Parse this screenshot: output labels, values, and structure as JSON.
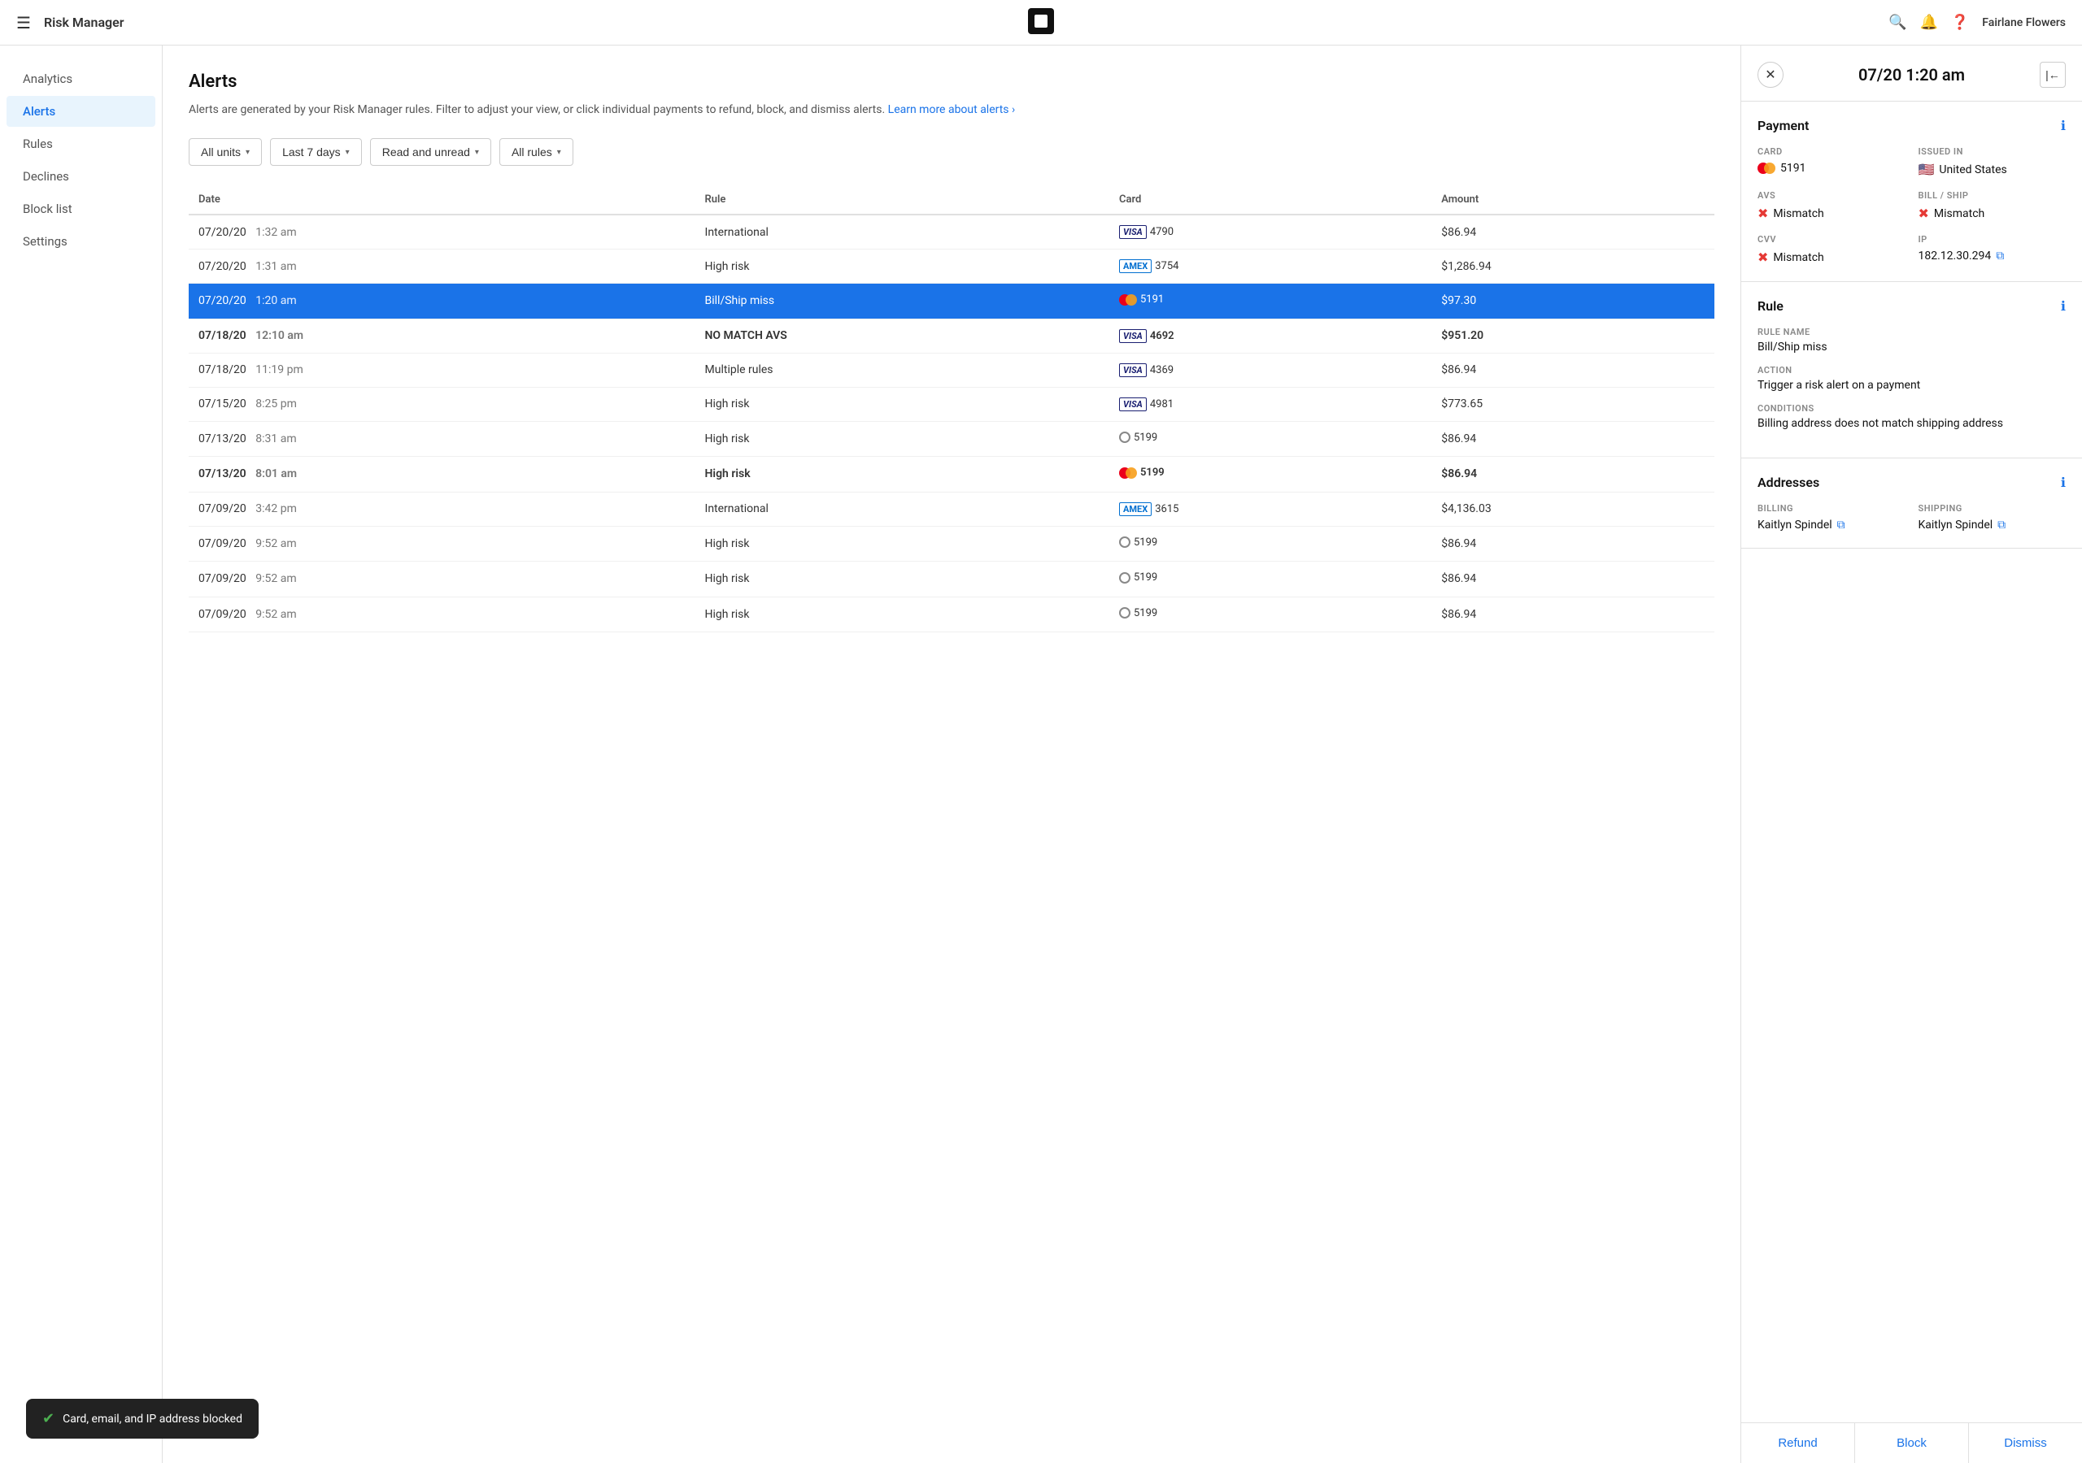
{
  "app": {
    "title": "Risk Manager",
    "user": "Fairlane Flowers",
    "logo_alt": "Square"
  },
  "topnav": {
    "search_label": "search",
    "bell_label": "notifications",
    "help_label": "help"
  },
  "sidebar": {
    "items": [
      {
        "id": "analytics",
        "label": "Analytics",
        "active": false
      },
      {
        "id": "alerts",
        "label": "Alerts",
        "active": true
      },
      {
        "id": "rules",
        "label": "Rules",
        "active": false
      },
      {
        "id": "declines",
        "label": "Declines",
        "active": false
      },
      {
        "id": "block-list",
        "label": "Block list",
        "active": false
      },
      {
        "id": "settings",
        "label": "Settings",
        "active": false
      }
    ]
  },
  "page": {
    "title": "Alerts",
    "description": "Alerts are generated by your Risk Manager rules. Filter to adjust your view, or click individual payments to refund, block, and dismiss alerts.",
    "learn_more": "Learn more about alerts ›"
  },
  "filters": [
    {
      "id": "units",
      "label": "All units"
    },
    {
      "id": "days",
      "label": "Last 7 days"
    },
    {
      "id": "read",
      "label": "Read and unread"
    },
    {
      "id": "rules",
      "label": "All rules"
    }
  ],
  "table": {
    "headers": [
      "Date",
      "Rule",
      "Card",
      "Amount"
    ],
    "rows": [
      {
        "date": "07/20/20",
        "time": "1:32 am",
        "rule": "International",
        "card_type": "visa",
        "card_num": "4790",
        "amount": "$86.94",
        "bold": false,
        "selected": false
      },
      {
        "date": "07/20/20",
        "time": "1:31 am",
        "rule": "High risk",
        "card_type": "amex",
        "card_num": "3754",
        "amount": "$1,286.94",
        "bold": false,
        "selected": false
      },
      {
        "date": "07/20/20",
        "time": "1:20 am",
        "rule": "Bill/Ship miss",
        "card_type": "mastercard",
        "card_num": "5191",
        "amount": "$97.30",
        "bold": false,
        "selected": true
      },
      {
        "date": "07/18/20",
        "time": "12:10 am",
        "rule": "NO MATCH AVS",
        "card_type": "visa",
        "card_num": "4692",
        "amount": "$951.20",
        "bold": true,
        "selected": false
      },
      {
        "date": "07/18/20",
        "time": "11:19 pm",
        "rule": "Multiple rules",
        "card_type": "visa",
        "card_num": "4369",
        "amount": "$86.94",
        "bold": false,
        "selected": false
      },
      {
        "date": "07/15/20",
        "time": "8:25 pm",
        "rule": "High risk",
        "card_type": "visa",
        "card_num": "4981",
        "amount": "$773.65",
        "bold": false,
        "selected": false
      },
      {
        "date": "07/13/20",
        "time": "8:31 am",
        "rule": "High risk",
        "card_type": "diners",
        "card_num": "5199",
        "amount": "$86.94",
        "bold": false,
        "selected": false
      },
      {
        "date": "07/13/20",
        "time": "8:01 am",
        "rule": "High risk",
        "card_type": "mastercard",
        "card_num": "5199",
        "amount": "$86.94",
        "bold": true,
        "selected": false
      },
      {
        "date": "07/09/20",
        "time": "3:42 pm",
        "rule": "International",
        "card_type": "amex",
        "card_num": "3615",
        "amount": "$4,136.03",
        "bold": false,
        "selected": false
      },
      {
        "date": "07/09/20",
        "time": "9:52 am",
        "rule": "High risk",
        "card_type": "diners",
        "card_num": "5199",
        "amount": "$86.94",
        "bold": false,
        "selected": false
      },
      {
        "date": "07/09/20",
        "time": "9:52 am",
        "rule": "High risk",
        "card_type": "diners",
        "card_num": "5199",
        "amount": "$86.94",
        "bold": false,
        "selected": false
      },
      {
        "date": "07/09/20",
        "time": "9:52 am",
        "rule": "High risk",
        "card_type": "diners",
        "card_num": "5199",
        "amount": "$86.94",
        "bold": false,
        "selected": false
      }
    ]
  },
  "panel": {
    "title": "07/20 1:20 am",
    "sections": {
      "payment": {
        "title": "Payment",
        "card_label": "CARD",
        "card_type": "mastercard",
        "card_num": "5191",
        "issued_in_label": "ISSUED IN",
        "issued_in_flag": "🇺🇸",
        "issued_in_value": "United States",
        "avs_label": "AVS",
        "avs_value": "Mismatch",
        "avs_status": "error",
        "bill_ship_label": "BILL / SHIP",
        "bill_ship_value": "Mismatch",
        "bill_ship_status": "error",
        "cvv_label": "CVV",
        "cvv_value": "Mismatch",
        "cvv_status": "error",
        "ip_label": "IP",
        "ip_value": "182.12.30.294"
      },
      "rule": {
        "title": "Rule",
        "rule_name_label": "RULE NAME",
        "rule_name_value": "Bill/Ship miss",
        "action_label": "ACTION",
        "action_value": "Trigger a risk alert on a payment",
        "conditions_label": "CONDITIONS",
        "conditions_value": "Billing address does not match shipping address"
      },
      "addresses": {
        "title": "Addresses",
        "billing_label": "BILLING",
        "billing_name": "Kaitlyn Spindel",
        "shipping_label": "SHIPPING",
        "shipping_name": "Kaitlyn Spindel"
      }
    },
    "actions": {
      "refund": "Refund",
      "block": "Block",
      "dismiss": "Dismiss"
    }
  },
  "toast": {
    "message": "Card, email, and IP address blocked"
  }
}
